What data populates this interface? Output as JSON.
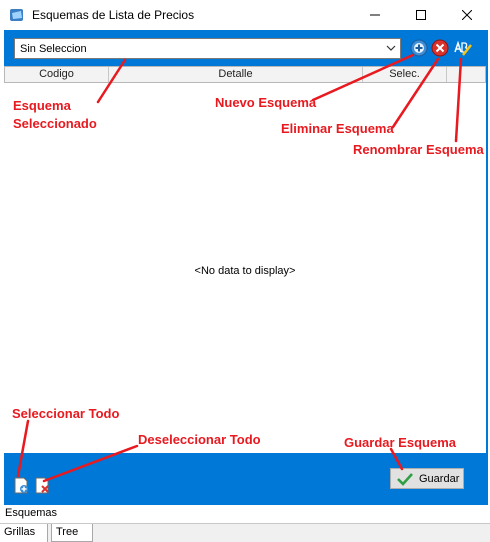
{
  "window": {
    "title": "Esquemas de Lista de Precios"
  },
  "toolbar": {
    "schema_select_value": "Sin Seleccion",
    "new_icon": "add-circle-icon",
    "delete_icon": "delete-circle-icon",
    "rename_icon": "rename-ab-icon"
  },
  "grid": {
    "columns": [
      "Codigo",
      "Detalle",
      "Selec."
    ],
    "empty_text": "<No data to display>"
  },
  "footer": {
    "save_label": "Guardar",
    "select_all_icon": "select-all-icon",
    "deselect_all_icon": "deselect-all-icon"
  },
  "status": {
    "label": "Esquemas"
  },
  "tabs": [
    "Grillas",
    "Tree"
  ],
  "annotations": {
    "schema_selected_1": "Esquema",
    "schema_selected_2": "Seleccionado",
    "new_schema": "Nuevo Esquema",
    "delete_schema": "Eliminar Esquema",
    "rename_schema": "Renombrar Esquema",
    "select_all": "Seleccionar Todo",
    "deselect_all": "Deseleccionar Todo",
    "save_schema": "Guardar Esquema"
  },
  "colors": {
    "frame_blue": "#0078d7",
    "annotation_red": "#e8191f"
  }
}
